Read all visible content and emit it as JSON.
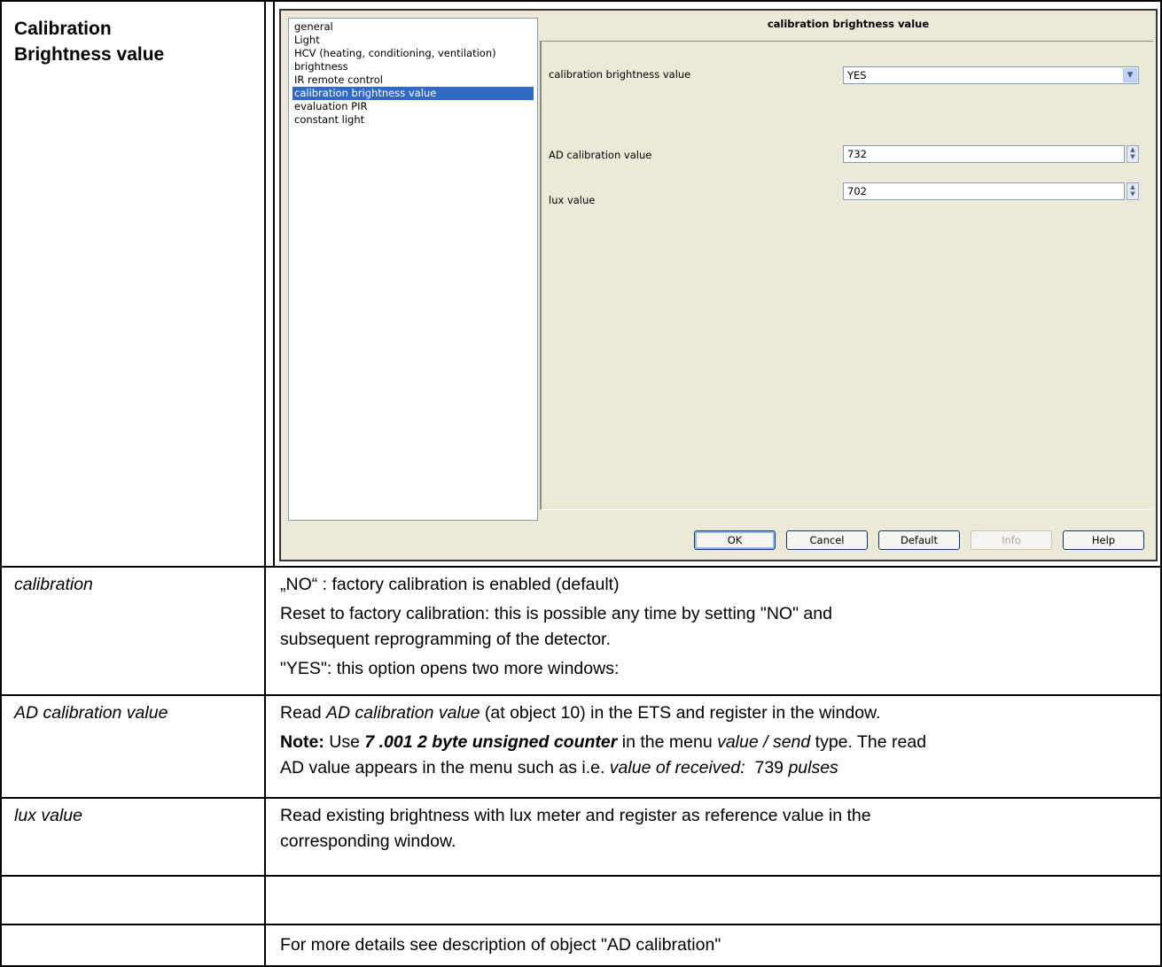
{
  "section": {
    "title_line1": "Calibration",
    "title_line2": "Brightness value"
  },
  "dialog": {
    "tree_items": [
      "general",
      "Light",
      "HCV (heating, conditioning, ventilation)",
      "brightness",
      "IR remote control",
      "calibration brightness value",
      "evaluation PIR",
      "constant light"
    ],
    "selected_tree_item": "calibration brightness value",
    "panel_title": "calibration brightness value",
    "fields": {
      "calibration_label": "calibration brightness value",
      "calibration_value": "YES",
      "ad_label": "AD calibration value",
      "ad_value": "732",
      "lux_label": "lux value",
      "lux_value": "702"
    },
    "buttons": {
      "ok": "OK",
      "cancel": "Cancel",
      "default": "Default",
      "info": "Info",
      "help": "Help"
    },
    "icons": {
      "dropdown": "chevron-down-icon",
      "spin": "spin-up-down-icon"
    }
  },
  "rows": {
    "calibration": {
      "label": "calibration",
      "line1": "„NO“ : factory calibration is enabled (default)",
      "line2": "Reset to factory calibration: this is possible any time by setting \"NO\" and",
      "line3": "subsequent reprogramming of the detector.",
      "line4": "\"YES\": this option opens two more windows:"
    },
    "ad": {
      "label": "AD calibration value",
      "read_prefix": "Read ",
      "read_italic": "AD calibration value",
      "read_suffix": " (at object 10) in the ETS and register in the window.",
      "note_label": "Note:",
      "note_use": " Use ",
      "note_bold_italic": "7 .001 2 byte unsigned counter",
      "note_in_menu": " in the menu ",
      "note_menu_italic": "value / send",
      "note_type": " type. The read",
      "line3_prefix": "AD value appears in the menu such as i.e. ",
      "line3_italic": "value of received:",
      "line3_value": "  739 ",
      "line3_unit": "pulses"
    },
    "lux": {
      "label": "lux value",
      "line1": "Read existing brightness with lux meter and register as reference value in the",
      "line2": "corresponding window."
    },
    "details": {
      "text": "For more details see description of object \"AD calibration\""
    }
  }
}
